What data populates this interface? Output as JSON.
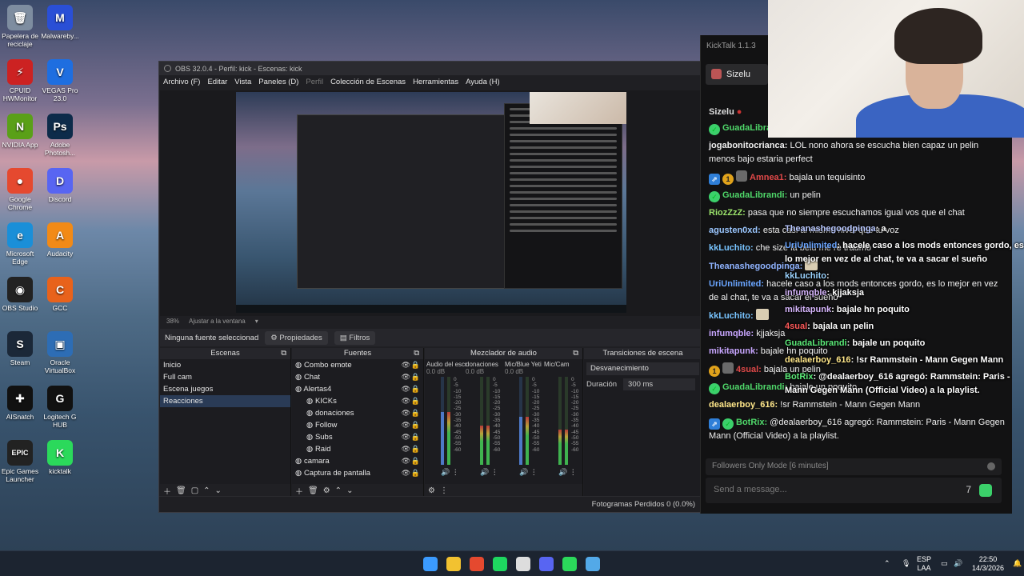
{
  "desktop": {
    "icons": [
      {
        "label": "Papelera de reciclaje",
        "color": "#7e8da0",
        "glyph": "🗑"
      },
      {
        "label": "Malwareby...",
        "color": "#2a4fd6",
        "glyph": "M"
      },
      {
        "label": "CPUID HWMonitor",
        "color": "#c22",
        "glyph": "⚡"
      },
      {
        "label": "VEGAS Pro 23.0",
        "color": "#1e6ee0",
        "glyph": "V"
      },
      {
        "label": "NVIDIA App",
        "color": "#5aa018",
        "glyph": "N"
      },
      {
        "label": "Adobe Photosh...",
        "color": "#0d2b4a",
        "glyph": "Ps"
      },
      {
        "label": "Google Chrome",
        "color": "#e5492f",
        "glyph": "●"
      },
      {
        "label": "Discord",
        "color": "#5865f2",
        "glyph": "D"
      },
      {
        "label": "Microsoft Edge",
        "color": "#1a8fd8",
        "glyph": "e"
      },
      {
        "label": "Audacity",
        "color": "#f28a16",
        "glyph": "A"
      },
      {
        "label": "OBS Studio",
        "color": "#222",
        "glyph": "◉"
      },
      {
        "label": "GCC",
        "color": "#e8621b",
        "glyph": "C"
      },
      {
        "label": "Steam",
        "color": "#1b2838",
        "glyph": "S"
      },
      {
        "label": "Oracle VirtualBox",
        "color": "#2d6db5",
        "glyph": "▣"
      },
      {
        "label": "AISnatch",
        "color": "#111",
        "glyph": "✚"
      },
      {
        "label": "Logitech G HUB",
        "color": "#111",
        "glyph": "G"
      },
      {
        "label": "Epic Games Launcher",
        "color": "#222",
        "glyph": "EPIC"
      },
      {
        "label": "kicktalk",
        "color": "#2bd95b",
        "glyph": "K"
      }
    ]
  },
  "obs": {
    "title": "OBS 32.0.4 - Perfil: kick - Escenas: kick",
    "menu": [
      "Archivo (F)",
      "Editar",
      "Vista",
      "Paneles (D)",
      "Perfil",
      "Colección de Escenas",
      "Herramientas",
      "Ayuda (H)"
    ],
    "zoom": "38%",
    "fit": "Ajustar a la ventana",
    "no_source": "Ninguna fuente seleccionad",
    "properties": "Propiedades",
    "filters": "Filtros",
    "docks": {
      "scenes_title": "Escenas",
      "sources_title": "Fuentes",
      "mixer_title": "Mezclador de audio",
      "transitions_title": "Transiciones de escena"
    },
    "scenes": [
      "Inicio",
      "Full cam",
      "Escena juegos",
      "Reacciones"
    ],
    "sources": [
      {
        "name": "Combo emote",
        "indent": 0
      },
      {
        "name": "Chat",
        "indent": 0
      },
      {
        "name": "Alertas4",
        "indent": 0
      },
      {
        "name": "KICKs",
        "indent": 1
      },
      {
        "name": "donaciones",
        "indent": 1
      },
      {
        "name": "Follow",
        "indent": 1
      },
      {
        "name": "Subs",
        "indent": 1
      },
      {
        "name": "Raid",
        "indent": 1
      },
      {
        "name": "camara",
        "indent": 0
      },
      {
        "name": "Captura de pantalla",
        "indent": 0
      }
    ],
    "mixer": [
      {
        "name": "Audio del escritorio",
        "db": "0.0 dB",
        "level": 0.6,
        "blue": true
      },
      {
        "name": "donaciones",
        "db": "0.0 dB",
        "level": 0.45,
        "blue": false
      },
      {
        "name": "Mic/Blue Yeti",
        "db": "0.0 dB",
        "level": 0.55,
        "blue": true
      },
      {
        "name": "Mic/Cam",
        "db": "",
        "level": 0.4,
        "blue": false
      }
    ],
    "scale": [
      "0",
      "-5",
      "-10",
      "-15",
      "-20",
      "-25",
      "-30",
      "-35",
      "-40",
      "-45",
      "-50",
      "-55",
      "-60"
    ],
    "transition": "Desvanecimiento",
    "duration_label": "Duración",
    "duration_value": "300 ms",
    "status": "Fotogramas Perdidos 0 (0.0%)"
  },
  "kicktalk": {
    "app_title": "KickTalk 1.1.3",
    "tab": "Sizelu",
    "channel": "Sizelu",
    "messages": [
      {
        "badges": [
          "ver"
        ],
        "user": "GuadaLibrandi",
        "color": "#4fd86a",
        "text": ""
      },
      {
        "badges": [],
        "user": "jogabonitocrianca:",
        "color": "#f0f0f0",
        "text": "LOL nono ahora se escucha bien capaz un pelin menos bajo estaria perfect"
      },
      {
        "badges": [
          "mod",
          "sub",
          "face"
        ],
        "user": "Amnea1:",
        "color": "#e04848",
        "text": "bajala un tequisinto"
      },
      {
        "badges": [
          "ver"
        ],
        "user": "GuadaLibrandi:",
        "color": "#4fd86a",
        "text": "un pelin"
      },
      {
        "badges": [],
        "user": "RiozZzZ:",
        "color": "#9be36b",
        "text": "pasa que no siempre escuchamos igual vos que el chat"
      },
      {
        "badges": [],
        "user": "agusten0xd:",
        "color": "#9bc7ff",
        "text": "esta casi al mismo nivel que tu voz"
      },
      {
        "badges": [],
        "user": "kkLuchito:",
        "color": "#78c4ff",
        "text": "che size la belu me re traumo"
      },
      {
        "badges": [],
        "user": "Theanashegoodpinga:",
        "color": "#8fb3ff",
        "text": ""
      },
      {
        "badges": [],
        "user": "UriUnlimited:",
        "color": "#6aa5ff",
        "text": "hacele caso a los mods entonces gordo, es lo mejor en vez de al chat, te va a sacar el sueño"
      },
      {
        "badges": [],
        "user": "kkLuchito:",
        "color": "#78c4ff",
        "text": ""
      },
      {
        "badges": [],
        "user": "infumqble:",
        "color": "#c8a6ff",
        "text": "kjjaksja"
      },
      {
        "badges": [],
        "user": "mikitapunk:",
        "color": "#c8a6ff",
        "text": "bajale hn poquito"
      },
      {
        "badges": [
          "sub",
          "face"
        ],
        "user": "4sual:",
        "color": "#e04848",
        "text": "bajala un pelin"
      },
      {
        "badges": [
          "ver"
        ],
        "user": "GuadaLibrandi:",
        "color": "#4fd86a",
        "text": "bajale un poquito"
      },
      {
        "badges": [],
        "user": "dealaerboy_616:",
        "color": "#ffe78a",
        "text": "!sr Rammstein - Mann Gegen Mann"
      },
      {
        "badges": [
          "mod",
          "ver"
        ],
        "user": "BotRix:",
        "color": "#4fd86a",
        "text": "@dealaerboy_616 agregó: Rammstein: Paris - Mann Gegen Mann (Official Video) a la playlist."
      }
    ],
    "overlay": [
      {
        "user": "Theanashegoodpinga",
        "color": "#b9c8ff",
        "text": ": a"
      },
      {
        "user": "UriUnlimited",
        "color": "#6aa5ff",
        "text": ": hacele caso a los mods entonces gordo, es lo mejor en vez de al chat, te va a sacar el sueño"
      },
      {
        "user": "kkLuchito",
        "color": "#9bd3ff",
        "text": ":"
      },
      {
        "user": "infumqble",
        "color": "#d9b8ff",
        "text": ": kjjaksja"
      },
      {
        "user": "mikitapunk",
        "color": "#d9b8ff",
        "text": ": bajale hn poquito"
      },
      {
        "user": "4sual",
        "color": "#ff5a5a",
        "text": ": bajala un pelin"
      },
      {
        "user": "GuadaLibrandi",
        "color": "#5bea78",
        "text": ": bajale un poquito"
      },
      {
        "user": "dealaerboy_616",
        "color": "#ffe78a",
        "text": ": !sr Rammstein - Mann Gegen Mann"
      },
      {
        "user": "BotRix",
        "color": "#5bea78",
        "text": ": @dealaerboy_616 agregó: Rammstein: Paris - Mann Gegen Mann (Official Video) a la playlist."
      }
    ],
    "followers_mode": "Followers Only Mode [6 minutes]",
    "input_placeholder": "Send a message..."
  },
  "taskbar": {
    "apps": [
      {
        "name": "windows-start",
        "color": "#3b9bff"
      },
      {
        "name": "file-explorer",
        "color": "#f2c230"
      },
      {
        "name": "chrome",
        "color": "#e5492f"
      },
      {
        "name": "spotify",
        "color": "#1ed760"
      },
      {
        "name": "obs",
        "color": "#ddd"
      },
      {
        "name": "discord",
        "color": "#5865f2"
      },
      {
        "name": "kicktalk",
        "color": "#2bd95b"
      },
      {
        "name": "notepad",
        "color": "#53a9e8"
      }
    ],
    "lang_top": "ESP",
    "lang_bottom": "LAA",
    "time": "22:50",
    "date": "14/3/2026"
  }
}
